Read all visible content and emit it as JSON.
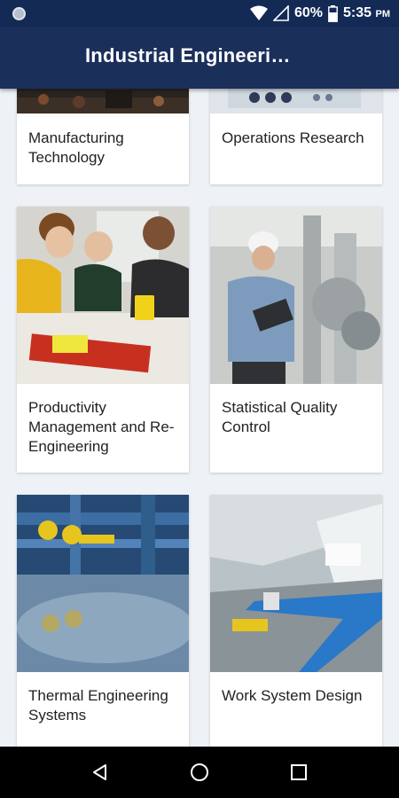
{
  "status_bar": {
    "battery_percent": "60%",
    "time": "5:35",
    "time_suffix": "PM"
  },
  "app_bar": {
    "title": "Industrial Engineeri…"
  },
  "cards": [
    {
      "label": "Manufacturing Technology",
      "image": "factory-interior"
    },
    {
      "label": "Operations Research",
      "image": "operations-panel"
    },
    {
      "label": "Productivity Management and Re-Engineering",
      "image": "team-meeting"
    },
    {
      "label": "Statistical Quality Control",
      "image": "engineer-with-clipboard"
    },
    {
      "label": "Thermal Engineering Systems",
      "image": "pipes-and-valves"
    },
    {
      "label": "Work System Design",
      "image": "conveyor-factory"
    }
  ],
  "nav_bar": {
    "icons": [
      "back-icon",
      "home-icon",
      "recents-icon"
    ]
  },
  "colors": {
    "status_bar": "#132a55",
    "app_bar": "#1b2f5b",
    "background": "#eef1f5",
    "card": "#ffffff"
  }
}
